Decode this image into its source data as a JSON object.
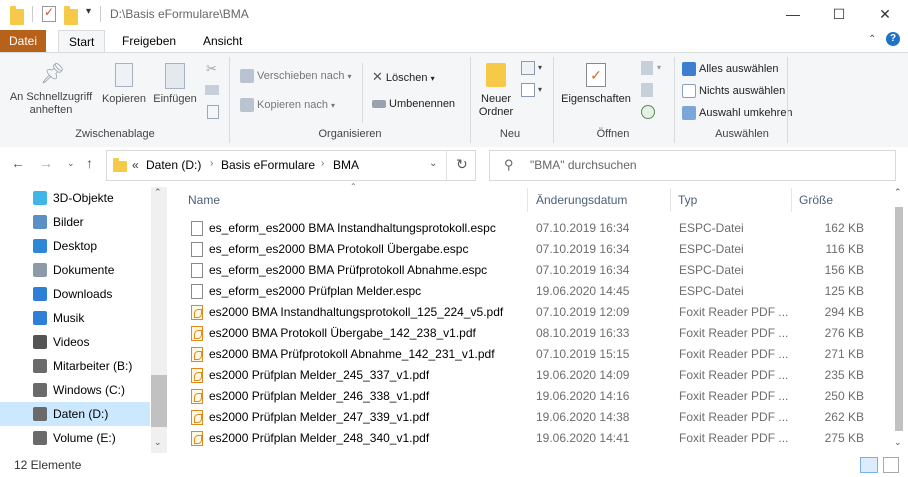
{
  "window": {
    "title": "D:\\Basis eFormulare\\BMA",
    "minimize": "—",
    "maximize": "☐",
    "close": "✕"
  },
  "ribbon_tabs": [
    "Datei",
    "Start",
    "Freigeben",
    "Ansicht"
  ],
  "ribbon": {
    "groups": {
      "clipboard": "Zwischenablage",
      "organize": "Organisieren",
      "new": "Neu",
      "open": "Öffnen",
      "select": "Auswählen"
    },
    "pin_line1": "An Schnellzugriff",
    "pin_line2": "anheften",
    "copy": "Kopieren",
    "paste": "Einfügen",
    "move_to": "Verschieben nach",
    "copy_to": "Kopieren nach",
    "delete": "Löschen",
    "rename": "Umbenennen",
    "new_folder_line1": "Neuer",
    "new_folder_line2": "Ordner",
    "properties": "Eigenschaften",
    "select_all": "Alles auswählen",
    "select_none": "Nichts auswählen",
    "invert_selection": "Auswahl umkehren"
  },
  "address": {
    "overflow": "«",
    "crumbs": [
      "Daten (D:)",
      "Basis eFormulare",
      "BMA"
    ],
    "search_placeholder": "\"BMA\" durchsuchen"
  },
  "sidebar": [
    {
      "label": "3D-Objekte",
      "icon": "3d-objects-icon",
      "color": "#3fb6e8"
    },
    {
      "label": "Bilder",
      "icon": "pictures-icon",
      "color": "#5a8fc8"
    },
    {
      "label": "Desktop",
      "icon": "desktop-icon",
      "color": "#2f87d8"
    },
    {
      "label": "Dokumente",
      "icon": "documents-icon",
      "color": "#8e9aa8"
    },
    {
      "label": "Downloads",
      "icon": "downloads-icon",
      "color": "#2f7fd8"
    },
    {
      "label": "Musik",
      "icon": "music-icon",
      "color": "#2f7fd8"
    },
    {
      "label": "Videos",
      "icon": "videos-icon",
      "color": "#555555"
    },
    {
      "label": "Mitarbeiter (B:)",
      "icon": "network-drive-icon",
      "color": "#6a6a6a"
    },
    {
      "label": "Windows (C:)",
      "icon": "drive-icon",
      "color": "#6a6a6a"
    },
    {
      "label": "Daten (D:)",
      "icon": "drive-icon",
      "color": "#6a6a6a",
      "selected": true
    },
    {
      "label": "Volume (E:)",
      "icon": "drive-icon",
      "color": "#6a6a6a"
    }
  ],
  "columns": {
    "name": "Name",
    "date": "Änderungsdatum",
    "type": "Typ",
    "size": "Größe"
  },
  "files": [
    {
      "name": "es_eform_es2000 BMA Instandhaltungsprotokoll.espc",
      "date": "07.10.2019 16:34",
      "type": "ESPC-Datei",
      "size": "162 KB",
      "icon": "document-icon"
    },
    {
      "name": "es_eform_es2000 BMA Protokoll Übergabe.espc",
      "date": "07.10.2019 16:34",
      "type": "ESPC-Datei",
      "size": "116 KB",
      "icon": "document-icon"
    },
    {
      "name": "es_eform_es2000 BMA Prüfprotokoll Abnahme.espc",
      "date": "07.10.2019 16:34",
      "type": "ESPC-Datei",
      "size": "156 KB",
      "icon": "document-icon"
    },
    {
      "name": "es_eform_es2000 Prüfplan Melder.espc",
      "date": "19.06.2020 14:45",
      "type": "ESPC-Datei",
      "size": "125 KB",
      "icon": "document-icon"
    },
    {
      "name": "es2000 BMA Instandhaltungsprotokoll_125_224_v5.pdf",
      "date": "07.10.2019 12:09",
      "type": "Foxit Reader PDF ...",
      "size": "294 KB",
      "icon": "pdf-icon"
    },
    {
      "name": "es2000 BMA Protokoll Übergabe_142_238_v1.pdf",
      "date": "08.10.2019 16:33",
      "type": "Foxit Reader PDF ...",
      "size": "276 KB",
      "icon": "pdf-icon"
    },
    {
      "name": "es2000 BMA Prüfprotokoll Abnahme_142_231_v1.pdf",
      "date": "07.10.2019 15:15",
      "type": "Foxit Reader PDF ...",
      "size": "271 KB",
      "icon": "pdf-icon"
    },
    {
      "name": "es2000 Prüfplan Melder_245_337_v1.pdf",
      "date": "19.06.2020 14:09",
      "type": "Foxit Reader PDF ...",
      "size": "235 KB",
      "icon": "pdf-icon"
    },
    {
      "name": "es2000 Prüfplan Melder_246_338_v1.pdf",
      "date": "19.06.2020 14:16",
      "type": "Foxit Reader PDF ...",
      "size": "250 KB",
      "icon": "pdf-icon"
    },
    {
      "name": "es2000 Prüfplan Melder_247_339_v1.pdf",
      "date": "19.06.2020 14:38",
      "type": "Foxit Reader PDF ...",
      "size": "262 KB",
      "icon": "pdf-icon"
    },
    {
      "name": "es2000 Prüfplan Melder_248_340_v1.pdf",
      "date": "19.06.2020 14:41",
      "type": "Foxit Reader PDF ...",
      "size": "275 KB",
      "icon": "pdf-icon"
    }
  ],
  "status": {
    "count": "12 Elemente"
  }
}
